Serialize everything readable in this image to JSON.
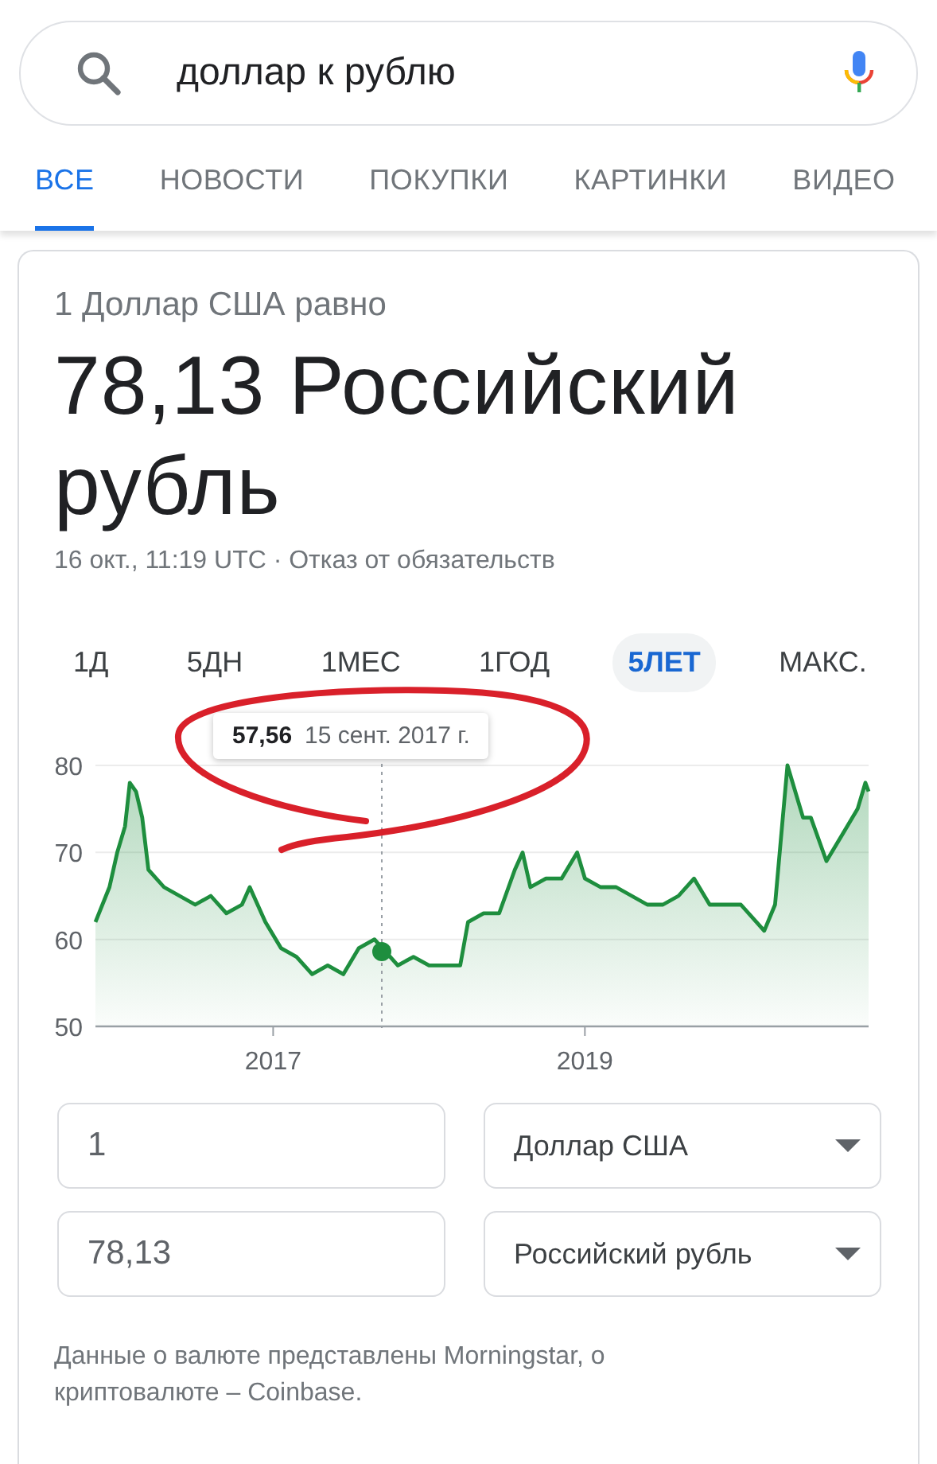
{
  "search": {
    "value": "доллар к рублю"
  },
  "tabs": [
    {
      "label": "ВСЕ",
      "selected": true
    },
    {
      "label": "НОВОСТИ",
      "selected": false
    },
    {
      "label": "ПОКУПКИ",
      "selected": false
    },
    {
      "label": "КАРТИНКИ",
      "selected": false
    },
    {
      "label": "ВИДЕО",
      "selected": false
    }
  ],
  "converter": {
    "subtitle": "1 Доллар США равно",
    "result": "78,13 Российский рубль",
    "timestamp": "16 окт., 11:19 UTC · Отказ от обязательств",
    "ranges": [
      {
        "label": "1Д",
        "selected": false
      },
      {
        "label": "5ДН",
        "selected": false
      },
      {
        "label": "1МЕС",
        "selected": false
      },
      {
        "label": "1ГОД",
        "selected": false
      },
      {
        "label": "5ЛЕТ",
        "selected": true
      },
      {
        "label": "МАКС.",
        "selected": false
      }
    ],
    "chart_data": {
      "type": "area",
      "xlim": [
        2015.86,
        2020.82
      ],
      "ylim": [
        50,
        80
      ],
      "yticks": [
        50,
        60,
        70,
        80
      ],
      "xticks": [
        2017,
        2019
      ],
      "x": [
        2015.86,
        2015.95,
        2016.0,
        2016.05,
        2016.08,
        2016.12,
        2016.16,
        2016.2,
        2016.3,
        2016.4,
        2016.5,
        2016.6,
        2016.7,
        2016.8,
        2016.85,
        2016.95,
        2017.05,
        2017.15,
        2017.25,
        2017.35,
        2017.45,
        2017.55,
        2017.65,
        2017.8,
        2017.9,
        2018.0,
        2018.1,
        2018.2,
        2018.25,
        2018.35,
        2018.45,
        2018.55,
        2018.6,
        2018.65,
        2018.75,
        2018.85,
        2018.95,
        2019.0,
        2019.1,
        2019.2,
        2019.3,
        2019.4,
        2019.5,
        2019.6,
        2019.7,
        2019.8,
        2019.9,
        2020.0,
        2020.1,
        2020.15,
        2020.22,
        2020.3,
        2020.4,
        2020.45,
        2020.55,
        2020.65,
        2020.75,
        2020.8,
        2020.82
      ],
      "series": [
        {
          "color": "#1e8e3e",
          "values": [
            62,
            66,
            70,
            73,
            78,
            77,
            74,
            68,
            66,
            65,
            64,
            65,
            63,
            64,
            66,
            62,
            59,
            58,
            56,
            57,
            56,
            59,
            60,
            57,
            58,
            57,
            57,
            57,
            62,
            63,
            63,
            68,
            70,
            66,
            67,
            67,
            70,
            67,
            66,
            66,
            65,
            64,
            64,
            65,
            67,
            64,
            64,
            64,
            62,
            61,
            64,
            80,
            74,
            74,
            69,
            72,
            75,
            78,
            77
          ]
        }
      ],
      "ylabel": null
    },
    "tooltip": {
      "value": "57,56",
      "date": "15 сент. 2017 г."
    },
    "amounts": [
      {
        "value": "1",
        "currency": "Доллар США"
      },
      {
        "value": "78,13",
        "currency": "Российский рубль"
      }
    ],
    "source": "Данные о валюте представлены Morningstar, о криптовалюте – Coinbase."
  }
}
